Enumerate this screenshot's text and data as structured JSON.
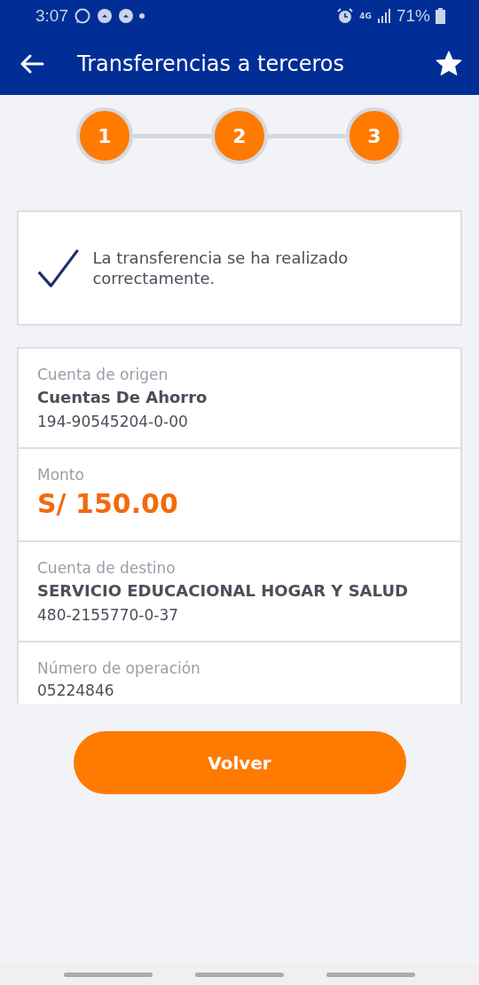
{
  "status_bar": {
    "time": "3:07",
    "battery": "71%",
    "network": "4G"
  },
  "app_bar": {
    "title": "Transferencias a terceros"
  },
  "steps": [
    {
      "label": "1",
      "done": true
    },
    {
      "label": "2",
      "done": true
    },
    {
      "label": "3",
      "done": true
    }
  ],
  "message": {
    "text": "La transferencia se ha realizado correctamente."
  },
  "details": [
    {
      "kind": "account",
      "label": "Cuenta de origen",
      "value": "Cuentas De Ahorro",
      "number": "194-90545204-0-00"
    },
    {
      "kind": "amount",
      "label": "Monto",
      "value": "S/ 150.00"
    },
    {
      "kind": "account",
      "label": "Cuenta de destino",
      "value": "SERVICIO EDUCACIONAL HOGAR Y SALUD",
      "number": "480-2155770-0-37"
    },
    {
      "kind": "reference",
      "label": "Número de operación",
      "value": "05224846"
    }
  ],
  "button": {
    "label": "Volver"
  }
}
